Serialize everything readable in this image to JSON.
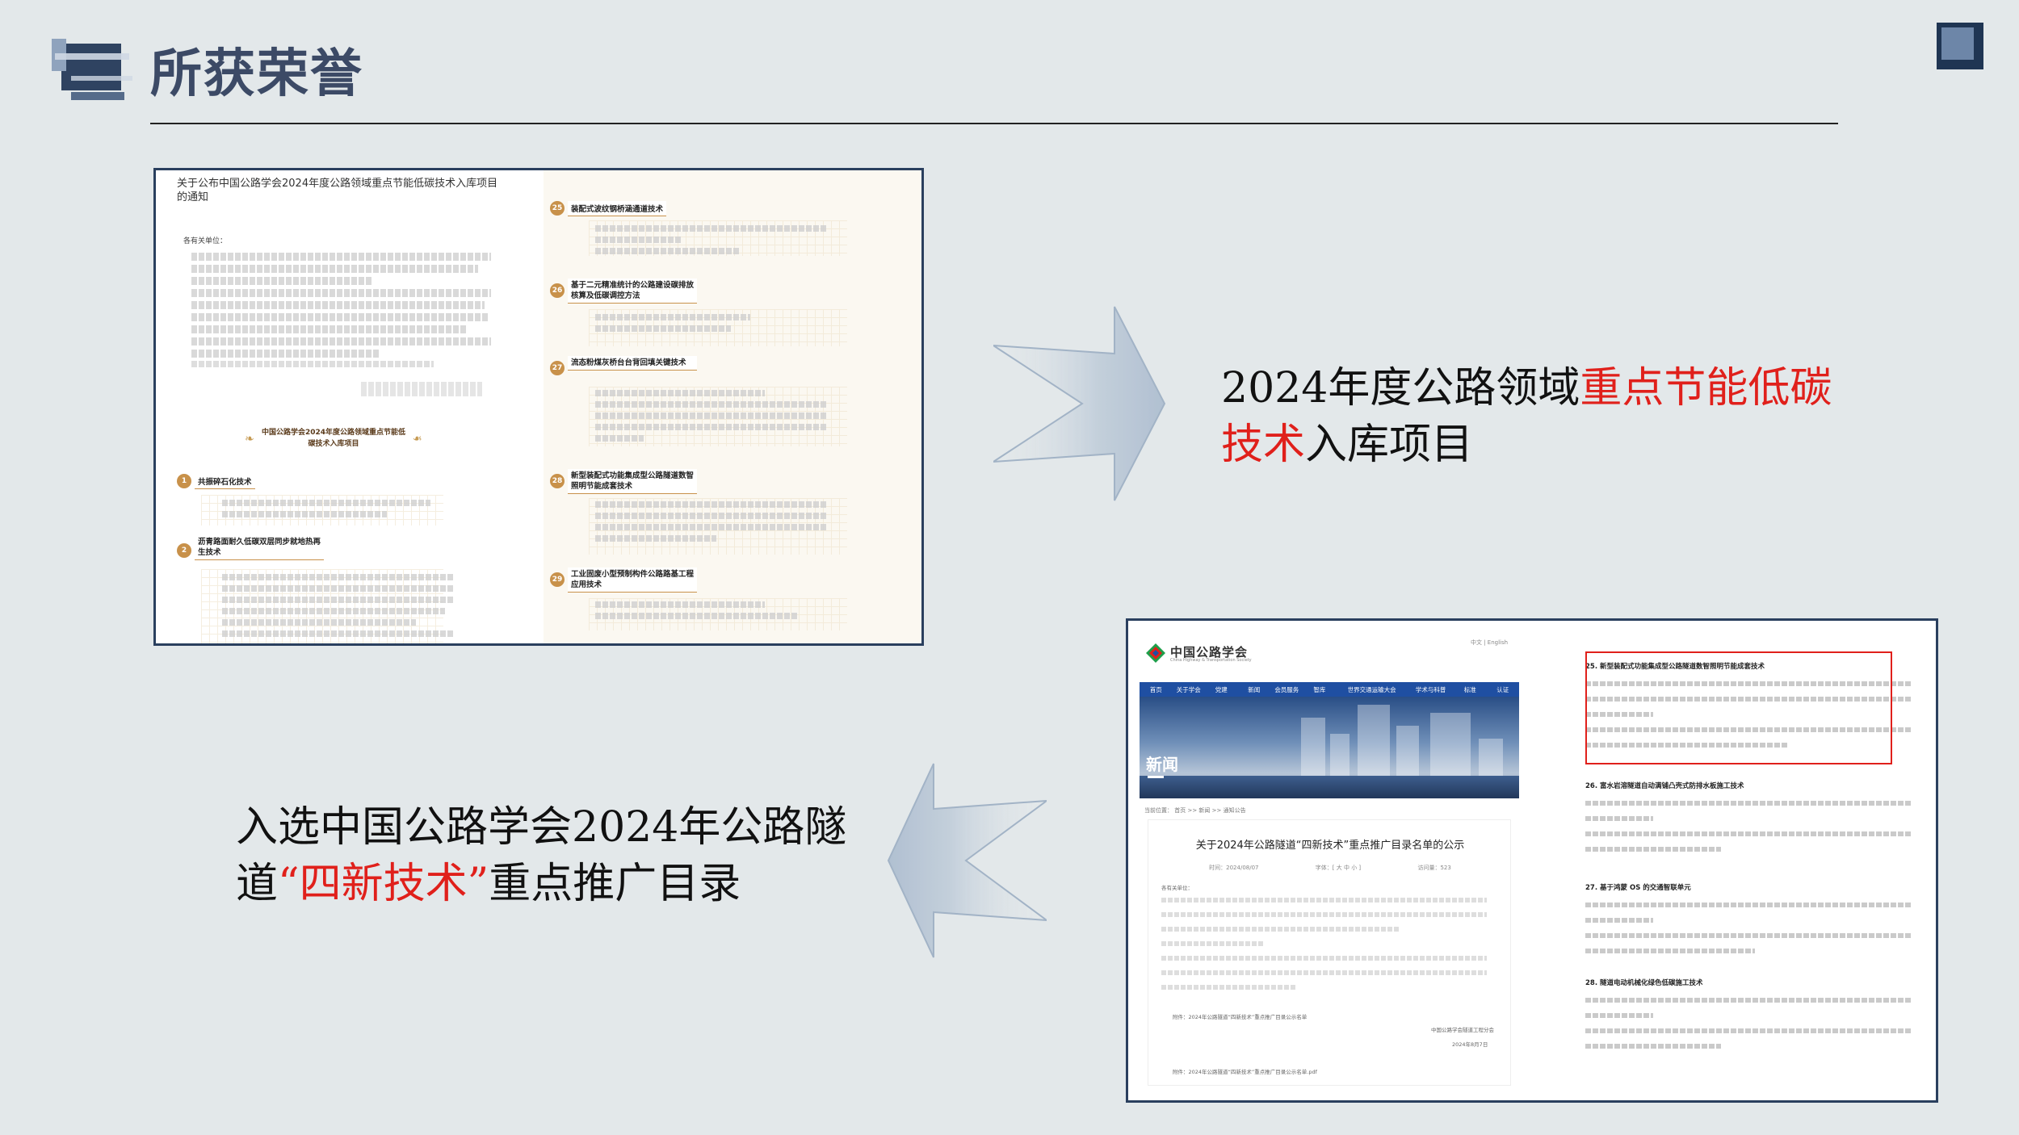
{
  "header": {
    "title": "所获荣誉"
  },
  "card1": {
    "notice_title": "关于公布中国公路学会2024年度公路领域重点节能低碳技术入库项目的通知",
    "greeting": "各有关单位：",
    "banner": "中国公路学会2024年度公路领域重点节能低碳技术入库项目",
    "items_left": [
      {
        "num": "1",
        "name": "共振碎石化技术"
      },
      {
        "num": "2",
        "name": "沥青路面耐久低碳双层同步就地热再生技术"
      }
    ],
    "items_right": [
      {
        "num": "25",
        "name": "装配式波纹钢桥涵通道技术"
      },
      {
        "num": "26",
        "name": "基于二元精准统计的公路建设碳排放核算及低碳调控方法"
      },
      {
        "num": "27",
        "name": "流态粉煤灰桥台台背回填关键技术"
      },
      {
        "num": "28",
        "name": "新型装配式功能集成型公路隧道数智照明节能成套技术"
      },
      {
        "num": "29",
        "name": "工业固废小型预制构件公路路基工程应用技术"
      }
    ]
  },
  "caption1": {
    "part1": "2024年度公路领域",
    "part2": "重点节能低碳技术",
    "part3": "入库项目"
  },
  "caption2": {
    "part1": "入选中国公路学会2024年公路隧道",
    "part2": "“四新技术”",
    "part3": "重点推广目录"
  },
  "card2": {
    "site_name": "中国公路学会",
    "site_sub": "China Highway & Transportation Society",
    "lang": "中文 | English",
    "nav": [
      "首页",
      "关于学会",
      "党建",
      "新闻",
      "会员服务",
      "智库",
      "世界交通运输大会",
      "学术与科普",
      "标准",
      "认证"
    ],
    "hero_label": "新闻",
    "crumb": "当前位置： 首页 >> 新闻 >> 通知公告",
    "article_title": "关于2024年公路隧道“四新技术”重点推广目录名单的公示",
    "meta": [
      "时间：2024/08/07",
      "字体：[ 大 中 小 ]",
      "访问量：523"
    ],
    "greeting": "各有关单位：",
    "attach": "附件：2024年公路隧道“四新技术”重点推广目录公示名单",
    "sign1": "中国公路学会隧道工程分会",
    "sign2": "2024年8月7日",
    "attach2": "附件：2024年公路隧道“四新技术”重点推广目录公示名单.pdf",
    "list": [
      {
        "h": "25. 新型装配式功能集成型公路隧道数智照明节能成套技术"
      },
      {
        "h": "26. 富水岩溶隧道自动满铺凸壳式防排水板施工技术"
      },
      {
        "h": "27. 基于鸿蒙 OS 的交通智联单元"
      },
      {
        "h": "28. 隧道电动机械化绿色低碳施工技术"
      }
    ]
  }
}
